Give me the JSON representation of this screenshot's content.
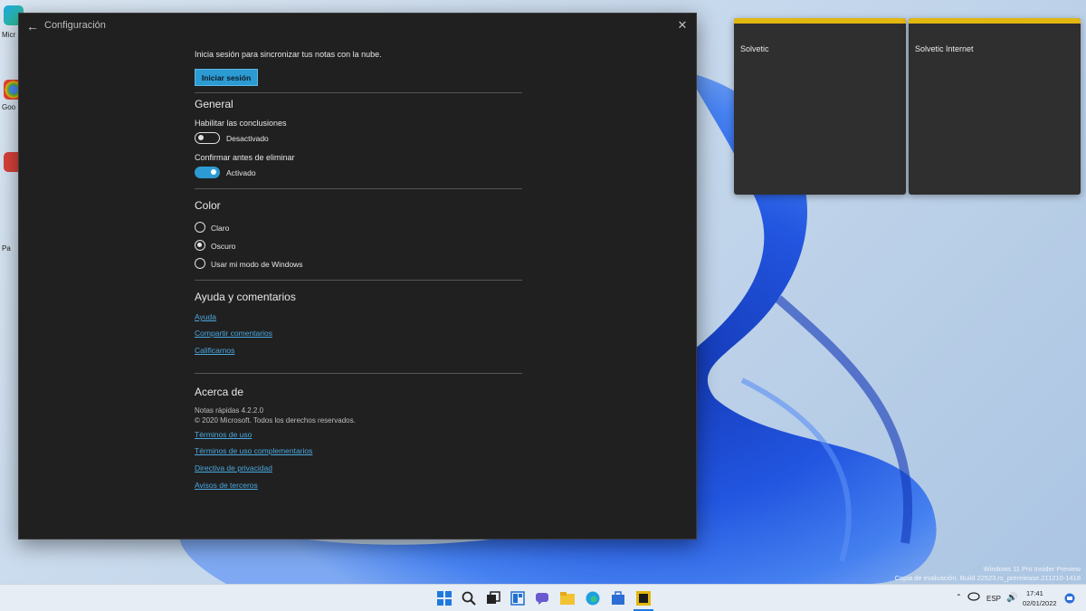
{
  "window": {
    "title": "Configuración",
    "sync_text": "Inicia sesión para sincronizar tus notas con la nube.",
    "signin_label": "Iniciar sesión"
  },
  "general": {
    "heading": "General",
    "insights_label": "Habilitar las conclusiones",
    "insights_state": "Desactivado",
    "insights_on": false,
    "confirm_label": "Confirmar antes de eliminar",
    "confirm_state": "Activado",
    "confirm_on": true
  },
  "color": {
    "heading": "Color",
    "options": [
      "Claro",
      "Oscuro",
      "Usar mi modo de Windows"
    ],
    "selected": "Oscuro"
  },
  "help": {
    "heading": "Ayuda y comentarios",
    "links": [
      "Ayuda",
      "Compartir comentarios",
      "Calificarnos"
    ]
  },
  "about": {
    "heading": "Acerca de",
    "version": "Notas rápidas 4.2.2.0",
    "copyright": "© 2020 Microsoft. Todos los derechos reservados.",
    "links": [
      "Términos de uso",
      "Términos de uso complementarios",
      "Directiva de privacidad",
      "Avisos de terceros"
    ]
  },
  "notes": [
    {
      "text": "Solvetic"
    },
    {
      "text": "Solvetic Internet"
    }
  ],
  "desktop": {
    "icons": [
      "edge-icon",
      "chrome-icon",
      "app-icon"
    ],
    "labels": [
      "Micr",
      "Goo",
      "Pa"
    ]
  },
  "watermark": {
    "line1": "Windows 11 Pro Insider Preview",
    "line2": "Copia de evaluación. Build 22523.rs_prerelease.211210-1418"
  },
  "taskbar": {
    "language": "ESP",
    "time": "17:41",
    "date": "02/01/2022"
  },
  "colors": {
    "accent": "#2d9bd3",
    "window_bg": "#202020",
    "note_bar": "#e2b710",
    "link": "#4aa8df"
  }
}
